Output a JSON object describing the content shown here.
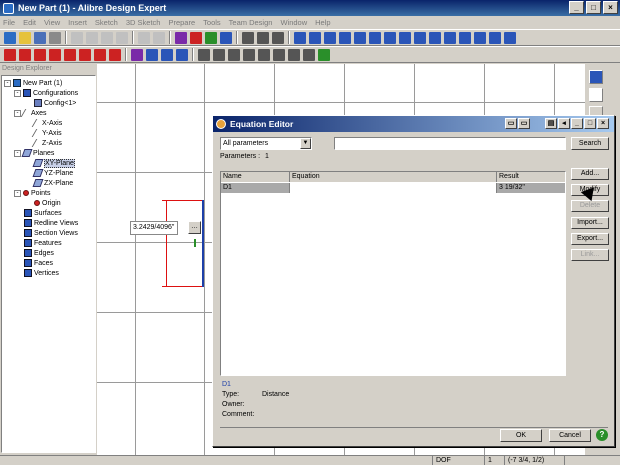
{
  "app": {
    "title": "New Part (1) - Alibre Design Expert"
  },
  "menu": [
    "File",
    "Edit",
    "View",
    "Insert",
    "Sketch",
    "3D Sketch",
    "Prepare",
    "Tools",
    "Team Design",
    "Window",
    "Help"
  ],
  "explorer": {
    "title": "Design Explorer",
    "tree": [
      {
        "label": "New Part (1)",
        "icon": "part-icon"
      },
      {
        "label": "Configurations",
        "icon": "folder-icon"
      },
      {
        "label": "Config<1>",
        "icon": "config-icon"
      },
      {
        "label": "Axes",
        "icon": "folder-icon"
      },
      {
        "label": "X-Axis",
        "icon": "axis-icon"
      },
      {
        "label": "Y-Axis",
        "icon": "axis-icon"
      },
      {
        "label": "Z-Axis",
        "icon": "axis-icon"
      },
      {
        "label": "Planes",
        "icon": "folder-icon"
      },
      {
        "label": "XY-Plane",
        "icon": "plane-icon"
      },
      {
        "label": "YZ-Plane",
        "icon": "plane-icon"
      },
      {
        "label": "ZX-Plane",
        "icon": "plane-icon"
      },
      {
        "label": "Points",
        "icon": "folder-icon"
      },
      {
        "label": "Origin",
        "icon": "point-icon"
      },
      {
        "label": "Surfaces",
        "icon": "folder-icon"
      },
      {
        "label": "Redline Views",
        "icon": "folder-icon"
      },
      {
        "label": "Section Views",
        "icon": "folder-icon"
      },
      {
        "label": "Features",
        "icon": "folder-icon"
      },
      {
        "label": "Edges",
        "icon": "folder-icon"
      },
      {
        "label": "Faces",
        "icon": "folder-icon"
      },
      {
        "label": "Vertices",
        "icon": "folder-icon"
      }
    ]
  },
  "canvas": {
    "dimension_value": "3.2429/4096\""
  },
  "dialog": {
    "title": "Equation Editor",
    "filter": "All parameters",
    "search_button": "Search",
    "parameters_label": "Parameters :",
    "parameters_count": "1",
    "columns": [
      "Name",
      "Equation",
      "Result"
    ],
    "rows": [
      {
        "name": "D1",
        "equation": "",
        "result": "3 19/32\""
      }
    ],
    "buttons": {
      "add": "Add...",
      "modify": "Modify",
      "delete": "Delete",
      "import": "Import...",
      "export": "Export...",
      "link": "Link..."
    },
    "info": {
      "name": "D1",
      "type_label": "Type:",
      "type_value": "Distance",
      "owner_label": "Owner:",
      "owner_value": "",
      "comment_label": "Comment:",
      "comment_value": ""
    },
    "ok": "OK",
    "cancel": "Cancel"
  },
  "status": {
    "dof_label": "DOF Remaining",
    "dof_value": "1",
    "coords": "(-7 3/4, 1/2)"
  }
}
